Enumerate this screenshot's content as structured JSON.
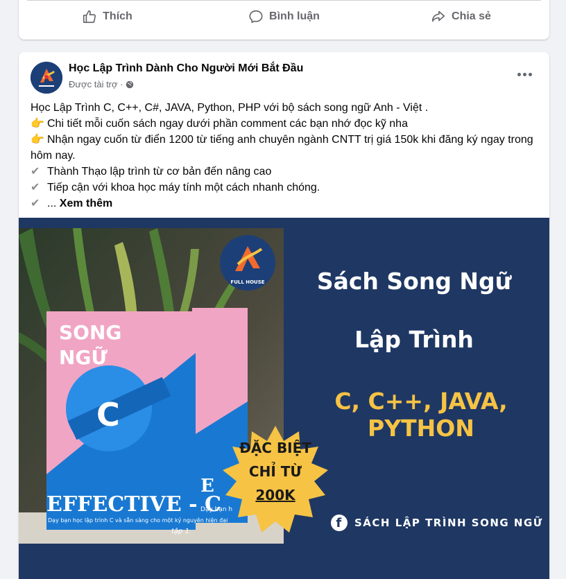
{
  "prev_actions": {
    "like": "Thích",
    "comment": "Bình luận",
    "share": "Chia sẻ"
  },
  "post": {
    "page_name": "Học Lập Trình Dành Cho Người Mới Bắt Đầu",
    "sponsored": "Được tài trợ ·",
    "lines": [
      "Học Lập Trình C, C++, C#, JAVA, Python, PHP với bộ sách song ngữ Anh - Việt .",
      "Chi tiết mỗi cuốn sách ngay dưới phần comment các bạn nhớ đọc kỹ nha",
      "Nhận ngay cuốn từ điển 1200 từ tiếng anh chuyên ngành CNTT  trị giá 150k khi đăng ký ngay trong hôm nay.",
      "Thành Thạo lập trình  từ cơ bản đến nâng cao",
      "Tiếp cận với khoa học máy tính một cách nhanh chóng.",
      "..."
    ],
    "see_more": "Xem thêm"
  },
  "image": {
    "logo_text": "FULL HOUSE",
    "headline_1": "Sách Song Ngữ",
    "headline_2": "Lập Trình",
    "headline_3": "C, C++, JAVA, PYTHON",
    "badge_1": "ĐẶC BIỆT",
    "badge_2": "CHỈ TỪ",
    "badge_price": "200K",
    "footer": "SÁCH LẬP TRÌNH SONG NGỮ",
    "fb_glyph": "f",
    "book": {
      "song": "SONG",
      "ngu": "NGỮ",
      "letter": "C",
      "title": "EFFECTIVE - C",
      "subtitle": "Dạy bạn học lập trình C và sẵn sàng cho một kỷ nguyên hiện đại",
      "volume": "tập 1",
      "back_title": "E",
      "back_sub": "Dạy bạn h"
    }
  },
  "colors": {
    "banner_bg": "#1f3763",
    "accent_yellow": "#f6c344",
    "book_pink": "#f1a5c4",
    "book_blue": "#1979d2"
  }
}
